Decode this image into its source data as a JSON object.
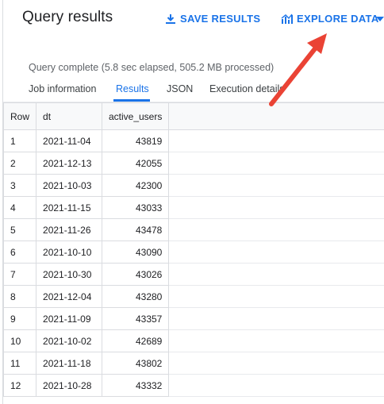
{
  "header": {
    "title": "Query results",
    "save_label": "SAVE RESULTS",
    "explore_label": "EXPLORE DATA"
  },
  "status": "Query complete (5.8 sec elapsed, 505.2 MB processed)",
  "tabs": [
    {
      "label": "Job information",
      "active": false
    },
    {
      "label": "Results",
      "active": true
    },
    {
      "label": "JSON",
      "active": false
    },
    {
      "label": "Execution details",
      "active": false
    }
  ],
  "table": {
    "columns": [
      "Row",
      "dt",
      "active_users"
    ],
    "rows": [
      [
        "1",
        "2021-11-04",
        "43819"
      ],
      [
        "2",
        "2021-12-13",
        "42055"
      ],
      [
        "3",
        "2021-10-03",
        "42300"
      ],
      [
        "4",
        "2021-11-15",
        "43033"
      ],
      [
        "5",
        "2021-11-26",
        "43478"
      ],
      [
        "6",
        "2021-10-10",
        "43090"
      ],
      [
        "7",
        "2021-10-30",
        "43026"
      ],
      [
        "8",
        "2021-12-04",
        "43280"
      ],
      [
        "9",
        "2021-11-09",
        "43357"
      ],
      [
        "10",
        "2021-10-02",
        "42689"
      ],
      [
        "11",
        "2021-11-18",
        "43802"
      ],
      [
        "12",
        "2021-10-28",
        "43332"
      ]
    ]
  },
  "colors": {
    "accent": "#1a73e8",
    "annotation_arrow": "#ea4335"
  },
  "icons": {
    "save": "download-icon",
    "explore": "explore-chart-icon",
    "dropdown": "caret-down-icon"
  }
}
